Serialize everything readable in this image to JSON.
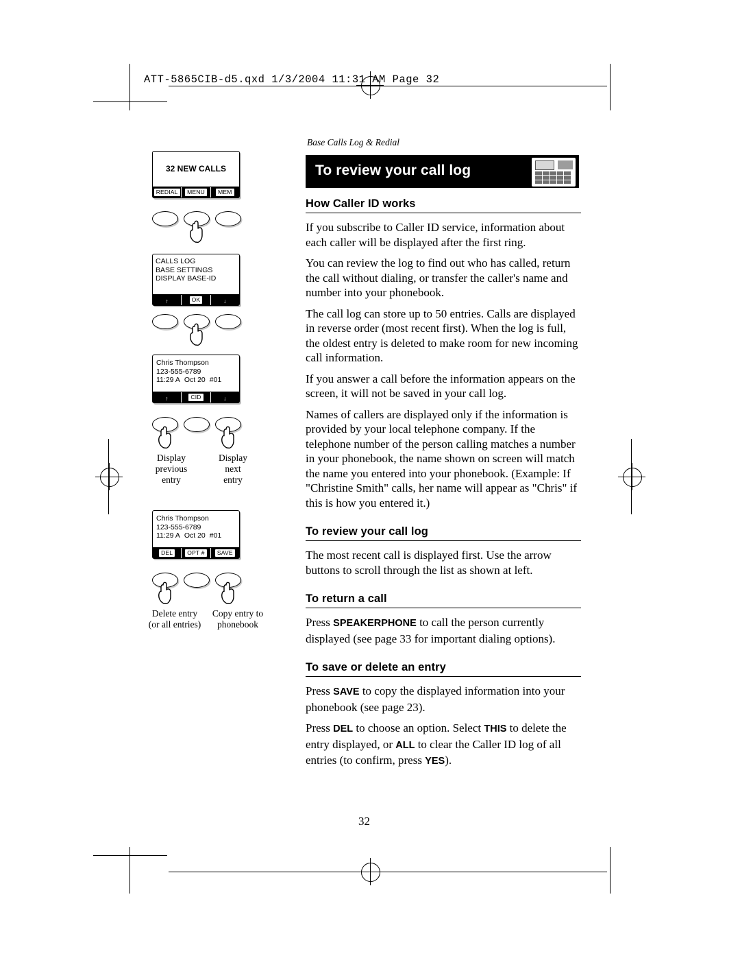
{
  "page": {
    "file_header": "ATT-5865CIB-d5.qxd  1/3/2004  11:31 AM  Page 32",
    "running_head": "Base Calls Log & Redial",
    "title": "To review your call log",
    "page_number": "32"
  },
  "sections": [
    {
      "heading": "How Caller ID works",
      "paragraphs": [
        "If you subscribe to Caller ID service, information about each caller will be displayed after the first ring.",
        "You can review the log to find out who has called, return the call without dialing, or transfer the caller's name and number into your phonebook.",
        "The call log can store up to 50 entries. Calls are displayed in reverse order (most recent first). When the log is full, the oldest entry is deleted to make room for new incoming call information.",
        "If you answer a call before the information appears on the screen, it will not be saved in your call log.",
        "Names of callers are displayed only if the information is provided by your local telephone company. If the telephone number of the person calling matches a number in your phonebook, the name shown on screen will match the name you entered into your phonebook. (Example: If \"Christine Smith\" calls, her name will appear as \"Chris\" if this is how you entered it.)"
      ]
    },
    {
      "heading": "To review your call log",
      "paragraphs": [
        "The most recent call is displayed first. Use the arrow buttons to scroll through the list as shown at left."
      ]
    },
    {
      "heading": "To return a call",
      "paragraphs": []
    },
    {
      "heading": "To save or delete an entry",
      "paragraphs": []
    }
  ],
  "return_call": {
    "pre": "Press ",
    "key": "SPEAKERPHONE",
    "post": " to call the person currently displayed (see page 33 for important dialing options)."
  },
  "save_delete": {
    "p1_pre": "Press ",
    "p1_key": "SAVE",
    "p1_post": " to copy the displayed information into your phonebook (see page 23).",
    "p2_pre": "Press ",
    "p2_key1": "DEL",
    "p2_mid1": " to choose an option. Select ",
    "p2_key2": "THIS",
    "p2_mid2": " to delete the entry displayed, or ",
    "p2_key3": "ALL",
    "p2_mid3": " to clear the Caller ID log of all entries (to confirm, press ",
    "p2_key4": "YES",
    "p2_end": ")."
  },
  "diagram": {
    "screen1": {
      "main_text": "32 NEW CALLS",
      "softkeys": [
        "REDIAL",
        "MENU",
        "MEM"
      ]
    },
    "screen2": {
      "lines": [
        "CALLS LOG",
        "BASE SETTINGS",
        "DISPLAY BASE-ID"
      ],
      "softkeys": [
        "↑",
        "OK",
        "↓"
      ]
    },
    "screen3": {
      "lines": [
        "Chris Thompson",
        "123-555-6789"
      ],
      "detail": [
        "11:29 A",
        "Oct 20",
        "#01"
      ],
      "softkeys": [
        "↑",
        "CID",
        "↓"
      ]
    },
    "screen4": {
      "lines": [
        "Chris Thompson",
        "123-555-6789"
      ],
      "detail": [
        "11:29 A",
        "Oct 20",
        "#01"
      ],
      "softkeys": [
        "DEL",
        "OPT #",
        "SAVE"
      ]
    },
    "captions": {
      "display_previous": "Display\nprevious\nentry",
      "display_next": "Display\nnext\nentry",
      "delete_entry": "Delete entry\n(or all entries)",
      "copy_entry": "Copy entry to\nphonebook"
    },
    "caption_lines": {
      "prev1": "Display",
      "prev2": "previous",
      "prev3": "entry",
      "next1": "Display",
      "next2": "next",
      "next3": "entry",
      "del1": "Delete entry",
      "del2": "(or all entries)",
      "copy1": "Copy entry to",
      "copy2": "phonebook"
    }
  }
}
